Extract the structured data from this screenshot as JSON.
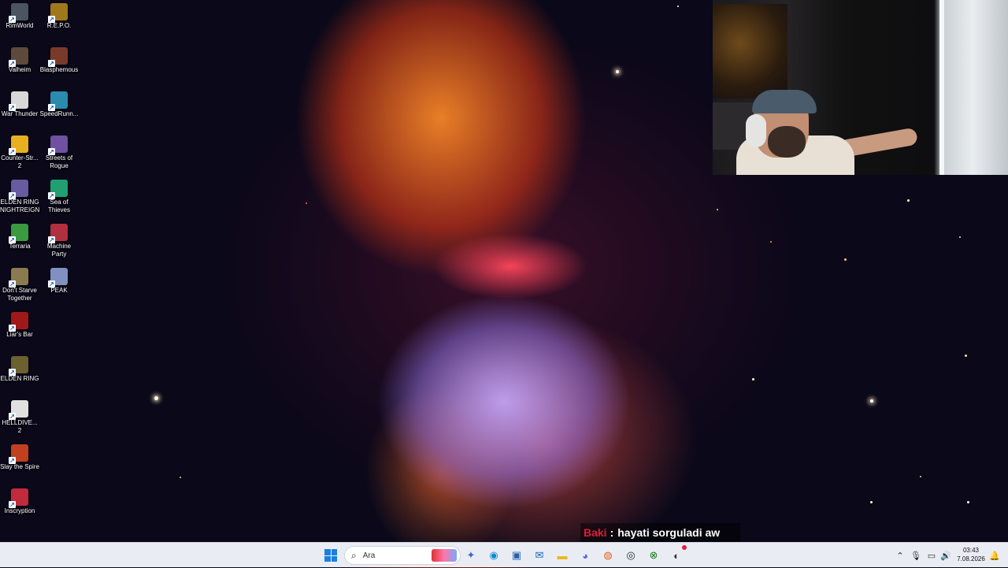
{
  "desktop": {
    "icons": [
      {
        "label": "RimWorld",
        "icon": "rimworld-icon",
        "color": "#4a5560"
      },
      {
        "label": "R.E.P.O.",
        "icon": "repo-icon",
        "color": "#a0781c"
      },
      {
        "label": "Valheim",
        "icon": "valheim-icon",
        "color": "#5c4a3c"
      },
      {
        "label": "Blasphemous",
        "icon": "blasphemous-icon",
        "color": "#7a3a2a"
      },
      {
        "label": "War Thunder",
        "icon": "war-thunder-icon",
        "color": "#d8d8d8"
      },
      {
        "label": "SpeedRunn...",
        "icon": "speedrunners-icon",
        "color": "#2b8ab0"
      },
      {
        "label": "Counter-Str... 2",
        "icon": "counter-strike-icon",
        "color": "#e8b020"
      },
      {
        "label": "Streets of Rogue",
        "icon": "streets-of-rogue-icon",
        "color": "#7050a0"
      },
      {
        "label": "ELDEN RING NIGHTREIGN",
        "icon": "elden-ring-nightreign-icon",
        "color": "#6a5aa0"
      },
      {
        "label": "Sea of Thieves",
        "icon": "sea-of-thieves-icon",
        "color": "#20a070"
      },
      {
        "label": "Terraria",
        "icon": "terraria-icon",
        "color": "#3a9a40"
      },
      {
        "label": "Machine Party",
        "icon": "machine-party-icon",
        "color": "#b03040"
      },
      {
        "label": "Don't Starve Together",
        "icon": "dont-starve-icon",
        "color": "#8a7a50"
      },
      {
        "label": "PEAK",
        "icon": "peak-icon",
        "color": "#8090c0"
      },
      {
        "label": "Liar's Bar",
        "icon": "liars-bar-icon",
        "color": "#a01818"
      },
      {
        "label": "ELDEN RING",
        "icon": "elden-ring-icon",
        "color": "#6a6030"
      },
      {
        "label": "HELLDIVE... 2",
        "icon": "helldivers-icon",
        "color": "#e0e0e0"
      },
      {
        "label": "Slay the Spire",
        "icon": "slay-the-spire-icon",
        "color": "#c04020"
      },
      {
        "label": "Inscryption",
        "icon": "inscryption-icon",
        "color": "#c02a3a"
      }
    ]
  },
  "chat_overlay": {
    "username": "Baki",
    "separator": ":",
    "message": "hayati sorguladi aw"
  },
  "taskbar": {
    "search_placeholder": "Ara",
    "apps": [
      {
        "name": "copilot-icon",
        "glyph": "✦",
        "color": "#3a6ad0"
      },
      {
        "name": "edge-icon",
        "glyph": "◉",
        "color": "#0c8ad8"
      },
      {
        "name": "store-icon",
        "glyph": "▣",
        "color": "#2860b0"
      },
      {
        "name": "outlook-icon",
        "glyph": "✉",
        "color": "#0a64c0"
      },
      {
        "name": "file-explorer-icon",
        "glyph": "▬",
        "color": "#e8b820"
      },
      {
        "name": "discord-icon",
        "glyph": "◕",
        "color": "#5865f2"
      },
      {
        "name": "firefox-icon",
        "glyph": "◍",
        "color": "#e8601c"
      },
      {
        "name": "steam-icon",
        "glyph": "◎",
        "color": "#1b2838"
      },
      {
        "name": "xbox-icon",
        "glyph": "⊗",
        "color": "#107c10"
      },
      {
        "name": "obs-icon",
        "glyph": "◐",
        "color": "#333333"
      }
    ],
    "clock_time": "03:43",
    "clock_date": "7.08.2026"
  }
}
